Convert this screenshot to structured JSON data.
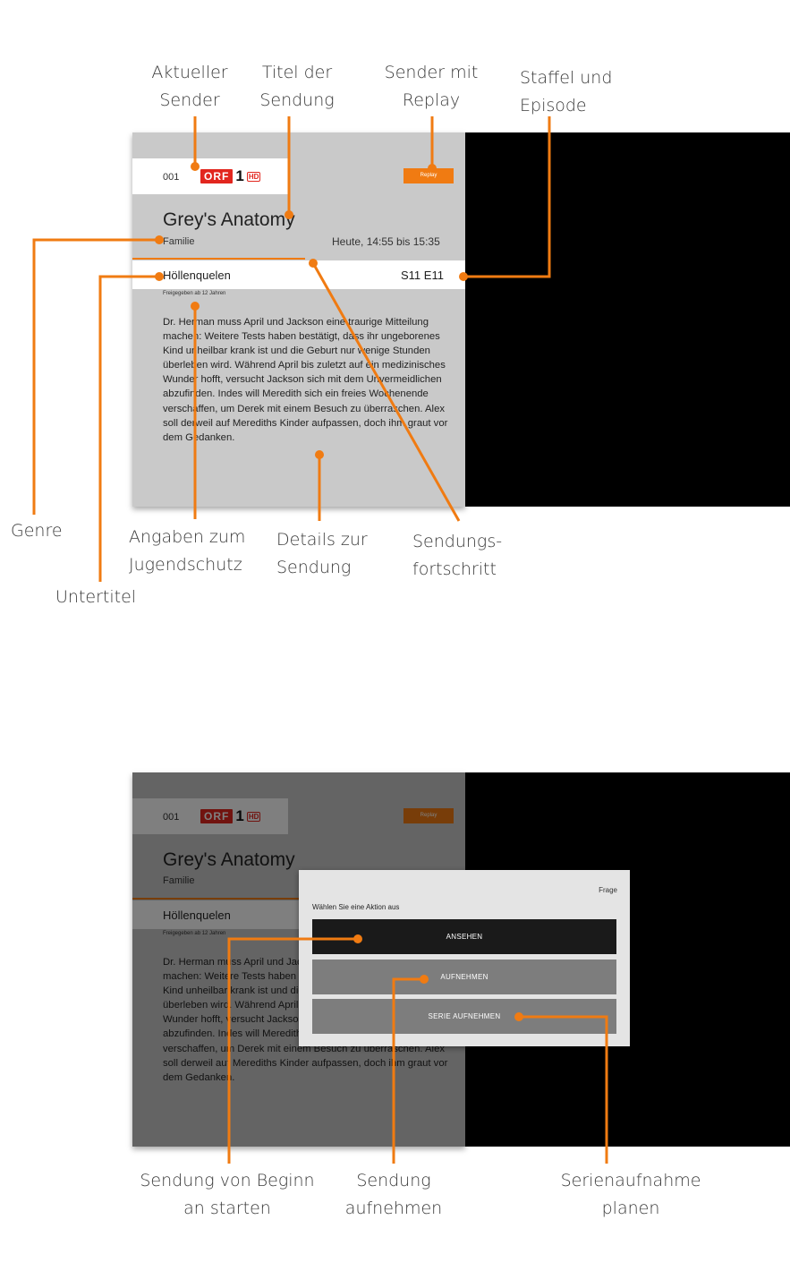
{
  "colors": {
    "accent": "#f07b12",
    "panel": "#c9c9c9",
    "video": "#000000",
    "dialog": "#e4e4e4"
  },
  "screen": {
    "channel_number": "001",
    "logo": {
      "brand": "ORF",
      "number": "1",
      "hd": "HD"
    },
    "replay_label": "Replay",
    "title": "Grey's Anatomy",
    "genre": "Familie",
    "time": "Heute, 14:55 bis 15:35",
    "subtitle": "Höllenquelen",
    "episode": "S11 E11",
    "age_rating": "Freigegeben ab 12 Jahren",
    "description": "Dr. Herman muss April und Jackson eine traurige Mitteilung machen: Weitere Tests haben bestätigt, dass ihr ungeborenes Kind unheilbar krank ist und die Geburt nur wenige Stunden überleben wird. Während April bis zuletzt auf ein medizinisches Wunder hofft, versucht Jackson sich mit dem Unvermeidlichen abzufinden. Indes will Meredith sich ein freies Wochenende verschaffen, um Derek mit einem Besuch zu überraschen. Alex soll derweil auf Merediths Kinder aufpassen, doch ihm graut vor dem Gedanken.",
    "progress": 0.52
  },
  "annotations_top": {
    "current_channel": "Aktueller\nSender",
    "show_title": "Titel der\nSendung",
    "replay_channel": "Sender mit\nReplay",
    "season_episode": "Staffel und\nEpisode",
    "genre": "Genre",
    "youth_protection": "Angaben zum\nJugendschutz",
    "details": "Details zur\nSendung",
    "progress": "Sendungs-\nfortschritt",
    "subtitle": "Untertitel"
  },
  "dialog": {
    "header": "Frage",
    "prompt": "Wählen Sie eine Aktion aus",
    "buttons": [
      "ANSEHEN",
      "AUFNEHMEN",
      "SERIE AUFNEHMEN"
    ]
  },
  "annotations_bottom": {
    "start_from_beginning": "Sendung von Beginn\nan starten",
    "record": "Sendung\naufnehmen",
    "series_record": "Serienaufnahme\nplanen"
  }
}
